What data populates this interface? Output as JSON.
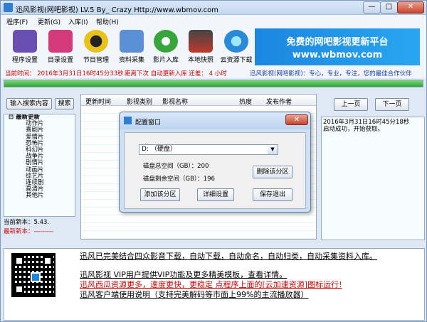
{
  "window": {
    "title": "迅风影视(网吧影视) LV.5 By_ Crazy Http://www.wbmov.com",
    "min_glyph": "—",
    "max_glyph": "□",
    "close_glyph": "✕"
  },
  "menu": [
    "程序(F)",
    "更新(G)",
    "入库(I)",
    "帮助(H)"
  ],
  "toolbar": [
    {
      "label": "程序设置",
      "icon": "program-settings-icon",
      "color": "#6a4fb3"
    },
    {
      "label": "目录设置",
      "icon": "directory-settings-icon",
      "color": "#d23a7a"
    },
    {
      "label": "节目管理",
      "icon": "program-manage-icon",
      "color": "#e8c21b"
    },
    {
      "label": "资料采集",
      "icon": "data-collect-icon",
      "color": "#5b8fd6"
    },
    {
      "label": "影片入库",
      "icon": "movie-import-icon",
      "color": "#36a53c"
    },
    {
      "label": "本地快照",
      "icon": "local-snapshot-icon",
      "color": "#c0392b"
    },
    {
      "label": "云资源下载",
      "icon": "cloud-download-icon",
      "color": "#2a8ad9"
    }
  ],
  "banner": {
    "line1": "免费的网吧影视更新平台",
    "line2": "www.wbmov.com"
  },
  "status": {
    "current_time": "当前时间： 2016年3月31日16时45分33秒",
    "next_update": "距离下次 自动更新入库 还差： 4 小时",
    "slogan": "迅风影视(网吧影视)：专心，专业，专注，您的最佳合作伙伴"
  },
  "progress": {
    "value": 1.0
  },
  "search": {
    "input_label": "输入搜索内容",
    "button": "搜索"
  },
  "tree": {
    "root": "最新更新",
    "items": [
      "动作片",
      "喜剧片",
      "爱情片",
      "恐怖片",
      "科幻片",
      "战争片",
      "剧情片",
      "动画片",
      "综艺片",
      "连续剧",
      "高清片",
      "其他片"
    ]
  },
  "version": {
    "current": "当前新本：5.43.",
    "latest": "最新新本：---------"
  },
  "list": {
    "columns": [
      "更新时间",
      "影视类别",
      "影视名称",
      "热度",
      "发布作者"
    ]
  },
  "pager": {
    "prev": "上一页",
    "next": "下一页"
  },
  "log": [
    "2016年3月31日16时45分18秒",
    "启动成功，开始获取。"
  ],
  "news": [
    {
      "text": "迅风已完美结合四众影音下载，自动下载，自动命名，自动归类，自动采集资料入库。",
      "color": "#1a3fa8"
    },
    {
      "text": "迅风影视 VIP用户提供VIP功能及更多精美模板，查看详情。",
      "color": "#1a3fa8"
    },
    {
      "text": "迅风西瓜资源更多，速度更快，更稳定 点程序上面的[云加速资源]图标运行!",
      "color": "#d00000"
    },
    {
      "text": "迅风客户端使用说明（支持完美解码等市面上99%的主流播放器）",
      "color": "#1a3fa8"
    }
  ],
  "dialog": {
    "title": "配置窗口",
    "close_glyph": "✕",
    "drive": "D: （硬盘）",
    "total": "磁盘总空间（GB）：200",
    "free": "磁盘剩余空间（GB）：196",
    "delete_partition": "删除该分区",
    "add_partition": "添加该分区",
    "detail_settings": "详细设置",
    "save_exit": "保存退出"
  }
}
